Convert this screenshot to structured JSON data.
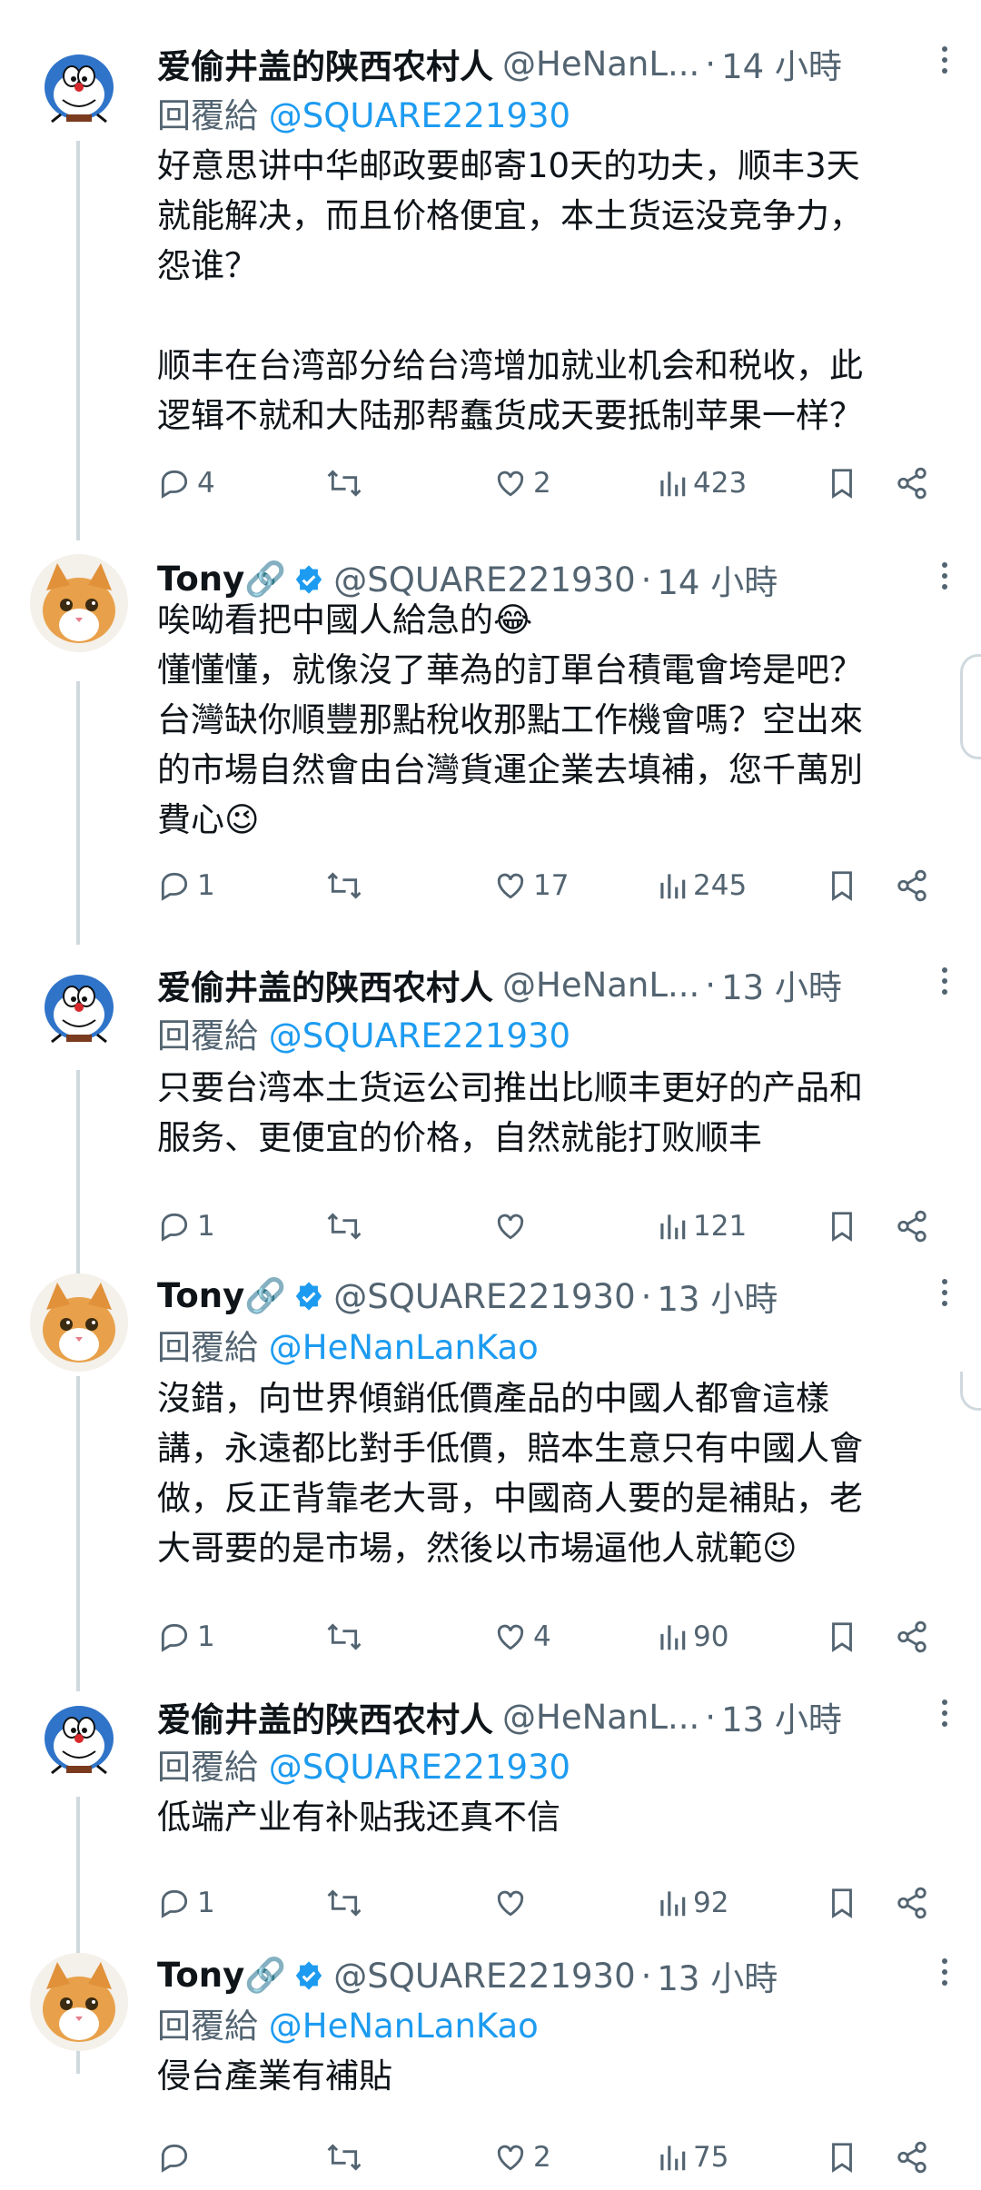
{
  "tweets": [
    {
      "author": "爱偷井盖的陕西农村人",
      "handle": "@HeNanL...",
      "time": "14 小時",
      "replying_label": "回覆給",
      "replying_to": "@SQUARE221930",
      "body": "好意思讲中华邮政要邮寄10天的功夫，顺丰3天\n就能解决，而且价格便宜，本土货运没竞争力，\n怨谁？\n\n顺丰在台湾部分给台湾增加就业机会和税收，此\n逻辑不就和大陆那帮蠢货成天要抵制苹果一样？",
      "replies": "4",
      "reposts": "",
      "likes": "2",
      "views": "423",
      "avatar": "doraemon"
    },
    {
      "author": "Tony🔗",
      "verified": true,
      "handle": "@SQUARE221930",
      "time": "14 小時",
      "replying_label": "",
      "replying_to": "",
      "body": "唉呦看把中國人給急的😂\n懂懂懂，就像沒了華為的訂單台積電會垮是吧？\n台灣缺你順豐那點稅收那點工作機會嗎？空出來\n的市場自然會由台灣貨運企業去填補，您千萬別\n費心😉",
      "replies": "1",
      "reposts": "",
      "likes": "17",
      "views": "245",
      "avatar": "cat"
    },
    {
      "author": "爱偷井盖的陕西农村人",
      "handle": "@HeNanL...",
      "time": "13 小時",
      "replying_label": "回覆給",
      "replying_to": "@SQUARE221930",
      "body": "只要台湾本土货运公司推出比顺丰更好的产品和\n服务、更便宜的价格，自然就能打败顺丰",
      "replies": "1",
      "reposts": "",
      "likes": "",
      "views": "121",
      "avatar": "doraemon"
    },
    {
      "author": "Tony🔗",
      "verified": true,
      "handle": "@SQUARE221930",
      "time": "13 小時",
      "replying_label": "回覆給",
      "replying_to": "@HeNanLanKao",
      "body": "沒錯，向世界傾銷低價產品的中國人都會這樣\n講，永遠都比對手低價，賠本生意只有中國人會\n做，反正背靠老大哥，中國商人要的是補貼，老\n大哥要的是市場，然後以市場逼他人就範😉",
      "replies": "1",
      "reposts": "",
      "likes": "4",
      "views": "90",
      "avatar": "cat"
    },
    {
      "author": "爱偷井盖的陕西农村人",
      "handle": "@HeNanL...",
      "time": "13 小時",
      "replying_label": "回覆給",
      "replying_to": "@SQUARE221930",
      "body": "低端产业有补贴我还真不信",
      "replies": "1",
      "reposts": "",
      "likes": "",
      "views": "92",
      "avatar": "doraemon"
    },
    {
      "author": "Tony🔗",
      "verified": true,
      "handle": "@SQUARE221930",
      "time": "13 小時",
      "replying_label": "回覆給",
      "replying_to": "@HeNanLanKao",
      "body": "侵台產業有補貼",
      "replies": "",
      "reposts": "",
      "likes": "2",
      "views": "75",
      "avatar": "cat"
    }
  ],
  "icons": {
    "reply": "reply-icon",
    "repost": "repost-icon",
    "like": "like-icon",
    "views": "views-icon",
    "bookmark": "bookmark-icon",
    "share": "share-icon",
    "more": "more-icon",
    "verified": "verified-badge-icon"
  },
  "colors": {
    "link": "#1d9bf0",
    "muted": "#536471",
    "text": "#0f1419",
    "verified": "#1d9bf0"
  }
}
